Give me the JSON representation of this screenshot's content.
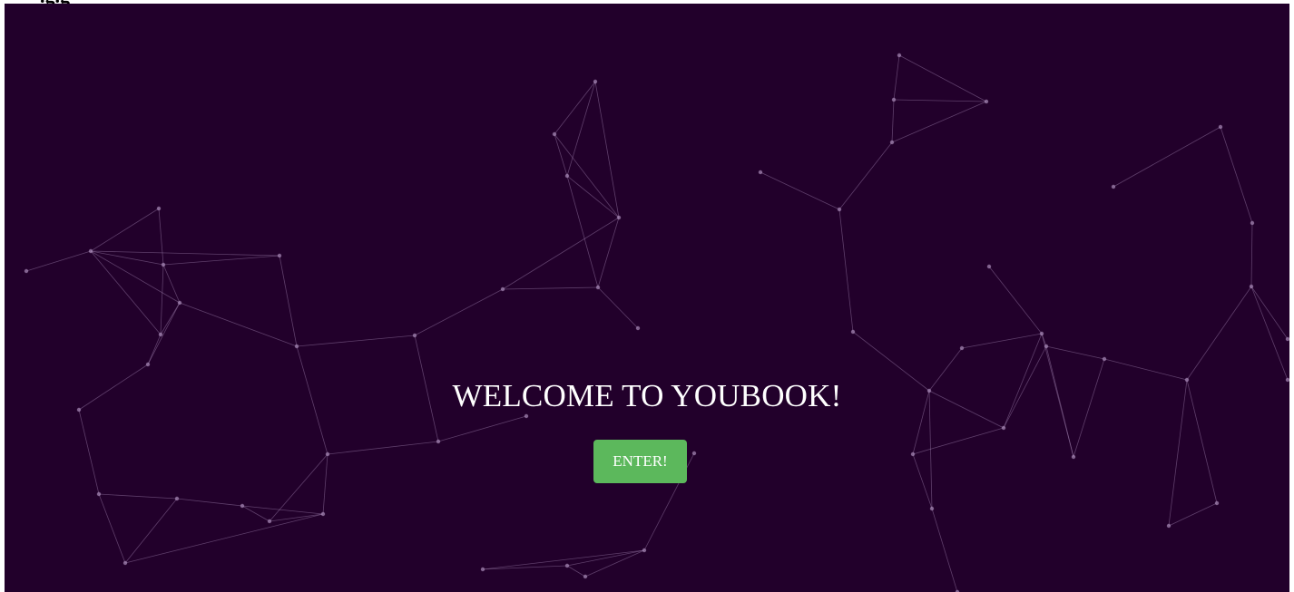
{
  "page": {
    "background_color": "#22002b",
    "network_color": "#a88ab8"
  },
  "hero": {
    "title": "WELCOME TO YOUBOOK!",
    "enter_label": "ENTER!",
    "button_color": "#5cb85c"
  }
}
